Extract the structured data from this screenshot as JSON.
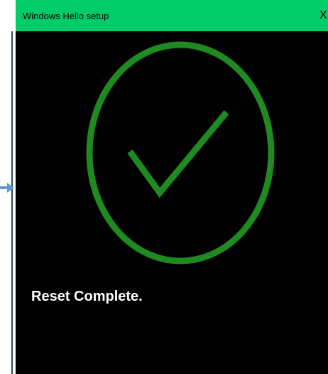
{
  "window": {
    "title": "Windows Hello setup",
    "close_glyph": "X",
    "status_message": "Reset Complete."
  },
  "icons": {
    "success": "checkmark-circle-icon",
    "pointer": "arrow-right-icon",
    "close": "close-icon"
  },
  "colors": {
    "titlebar": "#00cc6a",
    "background": "#000000",
    "check": "#1f8a1f",
    "status_text": "#ffffff"
  }
}
